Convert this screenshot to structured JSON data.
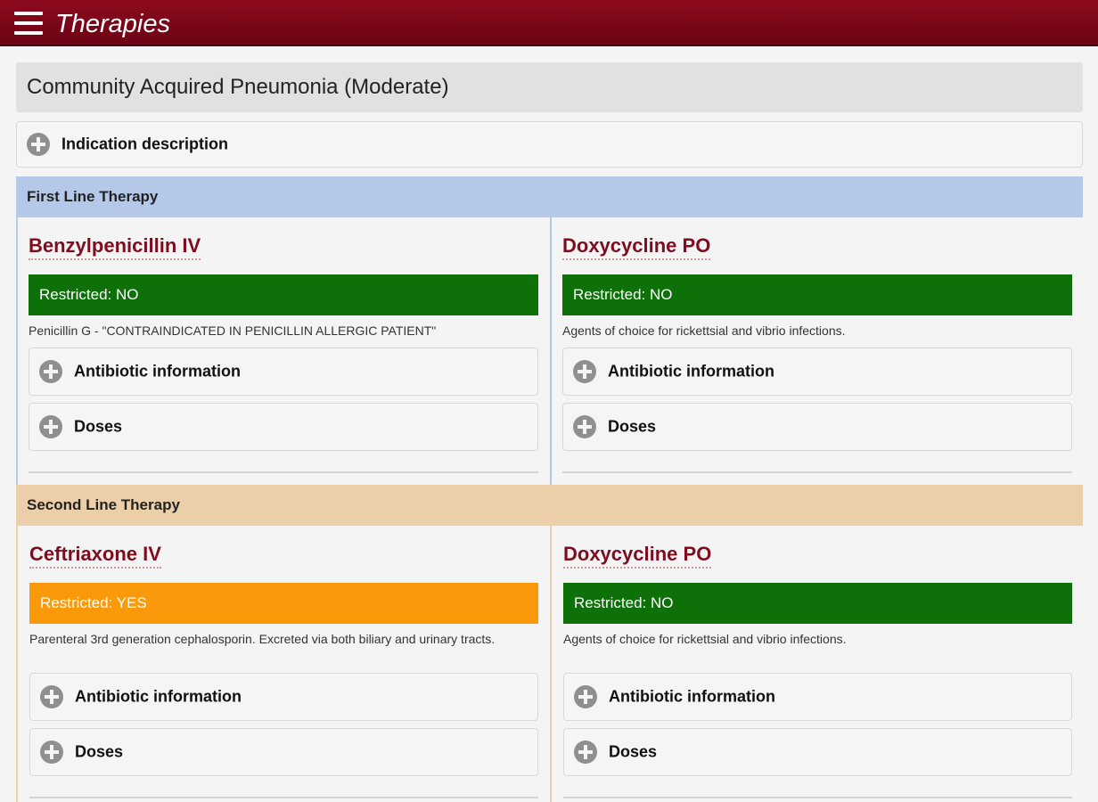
{
  "appbar": {
    "title": "Therapies"
  },
  "condition": {
    "title": "Community Acquired Pneumonia (Moderate)"
  },
  "indication": {
    "label": "Indication description"
  },
  "first_line": {
    "header": "First Line Therapy",
    "drugs": [
      {
        "name": "Benzylpenicillin IV",
        "restricted": "Restricted: NO",
        "description": "Penicillin G - \"CONTRAINDICATED IN PENICILLIN ALLERGIC PATIENT\"",
        "antibiotic_info": "Antibiotic information",
        "doses": "Doses"
      },
      {
        "name": "Doxycycline PO",
        "restricted": "Restricted: NO",
        "description": "Agents of choice for rickettsial and vibrio infections.",
        "antibiotic_info": "Antibiotic information",
        "doses": "Doses"
      }
    ]
  },
  "second_line": {
    "header": "Second Line Therapy",
    "drugs": [
      {
        "name": "Ceftriaxone IV",
        "restricted": "Restricted: YES",
        "description": "Parenteral 3rd generation cephalosporin. Excreted via both biliary and urinary tracts.",
        "antibiotic_info": "Antibiotic information",
        "doses": "Doses"
      },
      {
        "name": "Doxycycline PO",
        "restricted": "Restricted: NO",
        "description": "Agents of choice for rickettsial and vibrio infections.",
        "antibiotic_info": "Antibiotic information",
        "doses": "Doses"
      }
    ]
  },
  "colors": {
    "appbar": "#7a0618",
    "first_line_header": "#b5c8e8",
    "second_line_header": "#eccfa8",
    "restricted_no": "#0d7009",
    "restricted_yes": "#fa9a0a",
    "drug_name": "#7d0d1f"
  }
}
